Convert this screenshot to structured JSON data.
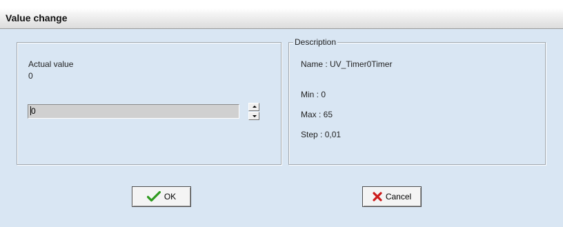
{
  "window": {
    "title": "Value change"
  },
  "left_panel": {
    "actual_value_label": "Actual value",
    "actual_value": "0",
    "input_value": "0"
  },
  "description": {
    "legend": "Description",
    "name": "Name : UV_Timer0Timer",
    "min": "Min : 0",
    "max": "Max : 65",
    "step": "Step : 0,01"
  },
  "buttons": {
    "ok_label": "OK",
    "cancel_label": "Cancel"
  },
  "icons": {
    "ok": "checkmark-icon",
    "cancel": "x-mark-icon"
  },
  "colors": {
    "dialog_bg": "#d9e6f3",
    "ok_icon": "#2e9a1e",
    "cancel_icon": "#cc1a1a"
  }
}
